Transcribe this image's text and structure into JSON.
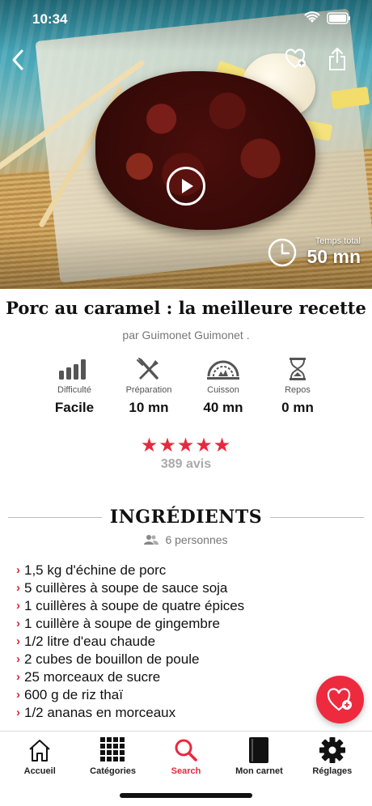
{
  "status_bar": {
    "time": "10:34"
  },
  "hero": {
    "total_time_label": "Temps total",
    "total_time_value": "50 mn"
  },
  "recipe": {
    "title": "Porc au caramel : la meilleure recette",
    "author": "par Guimonet Guimonet ."
  },
  "stats": [
    {
      "icon": "difficulty-bars-icon",
      "label": "Difficulté",
      "value": "Facile"
    },
    {
      "icon": "knife-fork-icon",
      "label": "Préparation",
      "value": "10 mn"
    },
    {
      "icon": "oven-icon",
      "label": "Cuisson",
      "value": "40 mn"
    },
    {
      "icon": "hourglass-icon",
      "label": "Repos",
      "value": "0 mn"
    }
  ],
  "rating": {
    "stars": "★★★★★",
    "stars_value": 5,
    "reviews": "389 avis"
  },
  "ingredients": {
    "heading": "INGRÉDIENTS",
    "servings": "6 personnes",
    "items": [
      "1,5 kg d'échine de porc",
      "5 cuillères à soupe de sauce soja",
      "1 cuillères à soupe de quatre épices",
      "1 cuillère à soupe de gingembre",
      "1/2 litre d'eau chaude",
      "2 cubes de bouillon de poule",
      "25 morceaux de sucre",
      "600 g de riz thaï",
      "1/2 ananas en morceaux"
    ]
  },
  "tabbar": {
    "tabs": [
      {
        "label": "Accueil",
        "icon": "home-icon"
      },
      {
        "label": "Catégories",
        "icon": "grid-icon"
      },
      {
        "label": "Search",
        "icon": "search-icon"
      },
      {
        "label": "Mon carnet",
        "icon": "notebook-icon"
      },
      {
        "label": "Réglages",
        "icon": "gear-icon"
      }
    ],
    "active": "Search"
  },
  "colors": {
    "accent": "#e8283e",
    "muted": "#777777"
  }
}
